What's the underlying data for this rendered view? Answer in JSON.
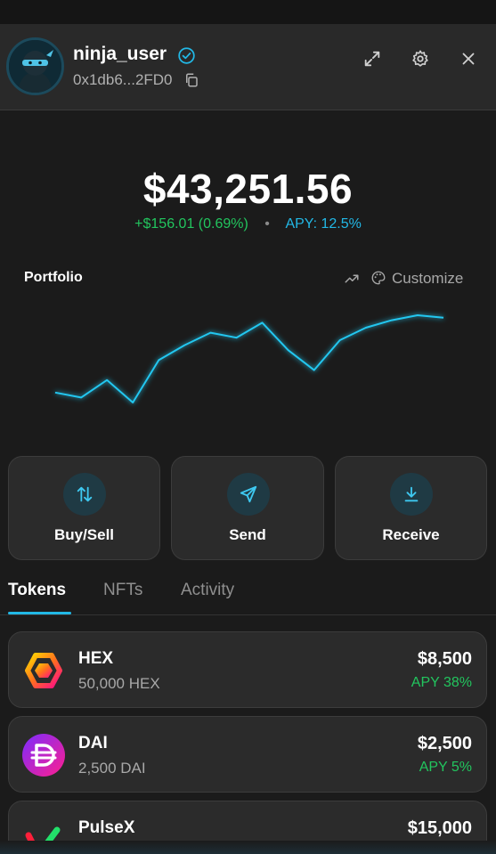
{
  "header": {
    "username": "ninja_user",
    "address": "0x1db6...2FD0"
  },
  "balance": {
    "total": "$43,251.56",
    "change": "+$156.01 (0.69%)",
    "separator": "•",
    "apy": "APY: 12.5%"
  },
  "portfolio": {
    "title": "Portfolio",
    "customize_label": "Customize",
    "chart_data": {
      "type": "line",
      "values": [
        12,
        10,
        17,
        8,
        25,
        31,
        36,
        34,
        40,
        29,
        21,
        33,
        38,
        41,
        43,
        42
      ]
    }
  },
  "actions": [
    {
      "label": "Buy/Sell",
      "icon": "arrows-up-down-icon"
    },
    {
      "label": "Send",
      "icon": "send-icon"
    },
    {
      "label": "Receive",
      "icon": "download-icon"
    }
  ],
  "tabs": [
    {
      "label": "Tokens",
      "active": true
    },
    {
      "label": "NFTs",
      "active": false
    },
    {
      "label": "Activity",
      "active": false
    }
  ],
  "tokens": [
    {
      "name": "HEX",
      "amount": "50,000 HEX",
      "value": "$8,500",
      "apy": "APY 38%"
    },
    {
      "name": "DAI",
      "amount": "2,500 DAI",
      "value": "$2,500",
      "apy": "APY 5%"
    },
    {
      "name": "PulseX",
      "amount": "",
      "value": "$15,000",
      "apy": ""
    }
  ],
  "colors": {
    "accent": "#22b8e6",
    "positive": "#22c55e",
    "background": "#1b1b1b",
    "card": "#2b2b2b"
  }
}
